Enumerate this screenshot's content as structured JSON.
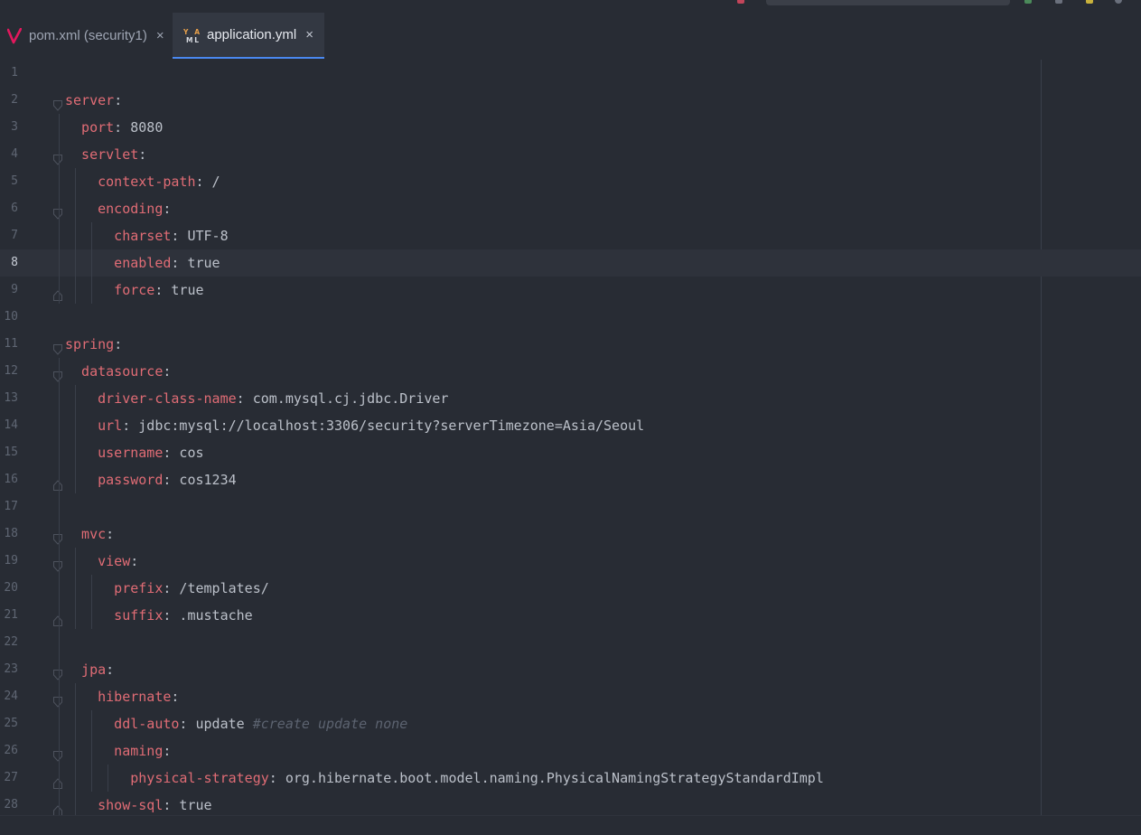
{
  "tabs": [
    {
      "label": "pom.xml (security1)",
      "icon": "maven-icon",
      "active": false
    },
    {
      "label": "application.yml",
      "icon": "yaml-icon",
      "active": true
    }
  ],
  "tab_close_glyph": "×",
  "yaml_icon_text": "YAML",
  "current_line": 8,
  "colors": {
    "background": "#282c34",
    "key": "#e06c75",
    "value": "#bbc0c9",
    "comment": "#5c6370",
    "active_tab_underline": "#4a88f0",
    "maven_icon": "#e2185d",
    "yaml_icon": "#e8a04a"
  },
  "lines": [
    {
      "n": "1",
      "indent": 0,
      "fold": "none"
    },
    {
      "n": "2",
      "indent": 0,
      "key": "server",
      "sep": ":",
      "fold": "open"
    },
    {
      "n": "3",
      "indent": 1,
      "key": "port",
      "sep": ": ",
      "value": "8080",
      "fold": "none"
    },
    {
      "n": "4",
      "indent": 1,
      "key": "servlet",
      "sep": ":",
      "fold": "open"
    },
    {
      "n": "5",
      "indent": 2,
      "key": "context-path",
      "sep": ": ",
      "value": "/",
      "fold": "none"
    },
    {
      "n": "6",
      "indent": 2,
      "key": "encoding",
      "sep": ":",
      "fold": "open"
    },
    {
      "n": "7",
      "indent": 3,
      "key": "charset",
      "sep": ": ",
      "value": "UTF-8",
      "fold": "none"
    },
    {
      "n": "8",
      "indent": 3,
      "key": "enabled",
      "sep": ": ",
      "value": "true",
      "fold": "none"
    },
    {
      "n": "9",
      "indent": 3,
      "key": "force",
      "sep": ": ",
      "value": "true",
      "fold": "end"
    },
    {
      "n": "10",
      "indent": 0,
      "fold": "none"
    },
    {
      "n": "11",
      "indent": 0,
      "key": "spring",
      "sep": ":",
      "fold": "open"
    },
    {
      "n": "12",
      "indent": 1,
      "key": "datasource",
      "sep": ":",
      "fold": "open"
    },
    {
      "n": "13",
      "indent": 2,
      "key": "driver-class-name",
      "sep": ": ",
      "value": "com.mysql.cj.jdbc.Driver",
      "fold": "none"
    },
    {
      "n": "14",
      "indent": 2,
      "key": "url",
      "sep": ": ",
      "value": "jdbc:mysql://localhost:3306/security?serverTimezone=Asia/Seoul",
      "fold": "none"
    },
    {
      "n": "15",
      "indent": 2,
      "key": "username",
      "sep": ": ",
      "value": "cos",
      "fold": "none"
    },
    {
      "n": "16",
      "indent": 2,
      "key": "password",
      "sep": ": ",
      "value": "cos1234",
      "fold": "end"
    },
    {
      "n": "17",
      "indent": 0,
      "fold": "none"
    },
    {
      "n": "18",
      "indent": 1,
      "key": "mvc",
      "sep": ":",
      "fold": "open"
    },
    {
      "n": "19",
      "indent": 2,
      "key": "view",
      "sep": ":",
      "fold": "open"
    },
    {
      "n": "20",
      "indent": 3,
      "key": "prefix",
      "sep": ": ",
      "value": "/templates/",
      "fold": "none"
    },
    {
      "n": "21",
      "indent": 3,
      "key": "suffix",
      "sep": ": ",
      "value": ".mustache",
      "fold": "end"
    },
    {
      "n": "22",
      "indent": 0,
      "fold": "none"
    },
    {
      "n": "23",
      "indent": 1,
      "key": "jpa",
      "sep": ":",
      "fold": "open"
    },
    {
      "n": "24",
      "indent": 2,
      "key": "hibernate",
      "sep": ":",
      "fold": "open"
    },
    {
      "n": "25",
      "indent": 3,
      "key": "ddl-auto",
      "sep": ": ",
      "value": "update ",
      "comment": "#create update none",
      "fold": "none"
    },
    {
      "n": "26",
      "indent": 3,
      "key": "naming",
      "sep": ":",
      "fold": "open"
    },
    {
      "n": "27",
      "indent": 4,
      "key": "physical-strategy",
      "sep": ": ",
      "value": "org.hibernate.boot.model.naming.PhysicalNamingStrategyStandardImpl",
      "fold": "end"
    },
    {
      "n": "28",
      "indent": 2,
      "key": "show-sql",
      "sep": ": ",
      "value": "true",
      "fold": "end"
    }
  ]
}
